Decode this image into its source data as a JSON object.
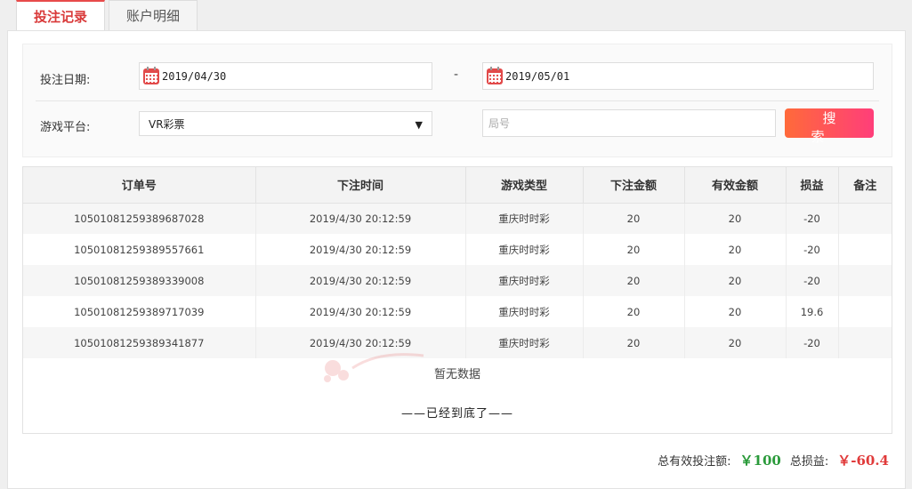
{
  "tabs": [
    {
      "label": "投注记录",
      "active": true
    },
    {
      "label": "账户明细",
      "active": false
    }
  ],
  "filter": {
    "date_label": "投注日期:",
    "start_date": "2019/04/30",
    "separator": "-",
    "end_date": "2019/05/01",
    "platform_label": "游戏平台:",
    "platform_value": "VR彩票",
    "round_placeholder": "局号",
    "search_label": "搜索"
  },
  "table": {
    "headers": [
      "订单号",
      "下注时间",
      "游戏类型",
      "下注金额",
      "有效金额",
      "损益",
      "备注"
    ],
    "rows": [
      [
        "10501081259389687028",
        "2019/4/30 20:12:59",
        "重庆时时彩",
        "20",
        "20",
        "-20",
        ""
      ],
      [
        "10501081259389557661",
        "2019/4/30 20:12:59",
        "重庆时时彩",
        "20",
        "20",
        "-20",
        ""
      ],
      [
        "10501081259389339008",
        "2019/4/30 20:12:59",
        "重庆时时彩",
        "20",
        "20",
        "-20",
        ""
      ],
      [
        "10501081259389717039",
        "2019/4/30 20:12:59",
        "重庆时时彩",
        "20",
        "20",
        "19.6",
        ""
      ],
      [
        "10501081259389341877",
        "2019/4/30 20:12:59",
        "重庆时时彩",
        "20",
        "20",
        "-20",
        ""
      ]
    ],
    "empty_text": "暂无数据",
    "end_text": "——已经到底了——"
  },
  "summary": {
    "valid_bet_label": "总有效投注额:",
    "valid_bet_value": "￥100",
    "profit_label": "总损益:",
    "profit_value": "￥-60.4"
  },
  "colors": {
    "accent": "#e84b4b",
    "positive": "#2a9a3a",
    "negative": "#e03a3a"
  }
}
